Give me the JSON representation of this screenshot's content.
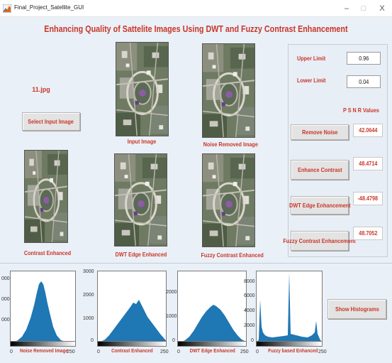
{
  "window": {
    "title": "Final_Project_Satellite_GUI",
    "minimize_glyph": "–",
    "maximize_glyph": "□",
    "close_glyph": "X"
  },
  "main_title": "Enhancing Quality of Sattelite Images Using DWT and Fuzzy Contrast Enhancement",
  "input": {
    "filename": "11.jpg",
    "select_button": "Select Input Image"
  },
  "images": {
    "input": "Input Image",
    "noise_removed": "Noise Removed Image",
    "contrast": "Contrast Enhanced",
    "dwt": "DWT Edge Enhanced",
    "fuzzy": "Fuzzy Contrast Enhanced"
  },
  "limits": {
    "upper_label": "Upper Limit",
    "upper_value": "0.96",
    "lower_label": "Lower Limit",
    "lower_value": "0.04"
  },
  "psnr": {
    "header": "P S N R Values",
    "rows": [
      {
        "button": "Remove Noise",
        "value": "42.0644"
      },
      {
        "button": "Enhance Contrast",
        "value": "48.4714"
      },
      {
        "button": "DWT Edge Enhancement",
        "value": "-48.4798"
      },
      {
        "button": "Fuzzy Contrast Enhancement",
        "value": "48.7052"
      }
    ]
  },
  "histograms": {
    "button": "Show Histograms",
    "panels": [
      {
        "label": "Noise Removed Image",
        "y_ticks": [
          "000",
          "000",
          "000"
        ],
        "x_ticks": [
          "0",
          "250"
        ]
      },
      {
        "label": "Contrast Enhanced",
        "y_ticks": [
          "3000",
          "2000",
          "1000",
          "0"
        ],
        "x_ticks": [
          "0",
          "250"
        ]
      },
      {
        "label": "DWT Edge Enhanced",
        "y_ticks": [
          "2000",
          "1000",
          "0"
        ],
        "x_ticks": [
          "0",
          "250"
        ]
      },
      {
        "label": "Fuzzy based Enhanced",
        "y_ticks": [
          "8000",
          "6000",
          "4000",
          "2000",
          "0"
        ],
        "x_ticks": [
          "0",
          "250"
        ]
      }
    ]
  },
  "colors": {
    "accent_red": "#c8372a",
    "histogram_blue": "#1f77b4",
    "figure_bg": "#eaf0f7"
  },
  "icons": {
    "app": "matlab-figure-icon"
  }
}
